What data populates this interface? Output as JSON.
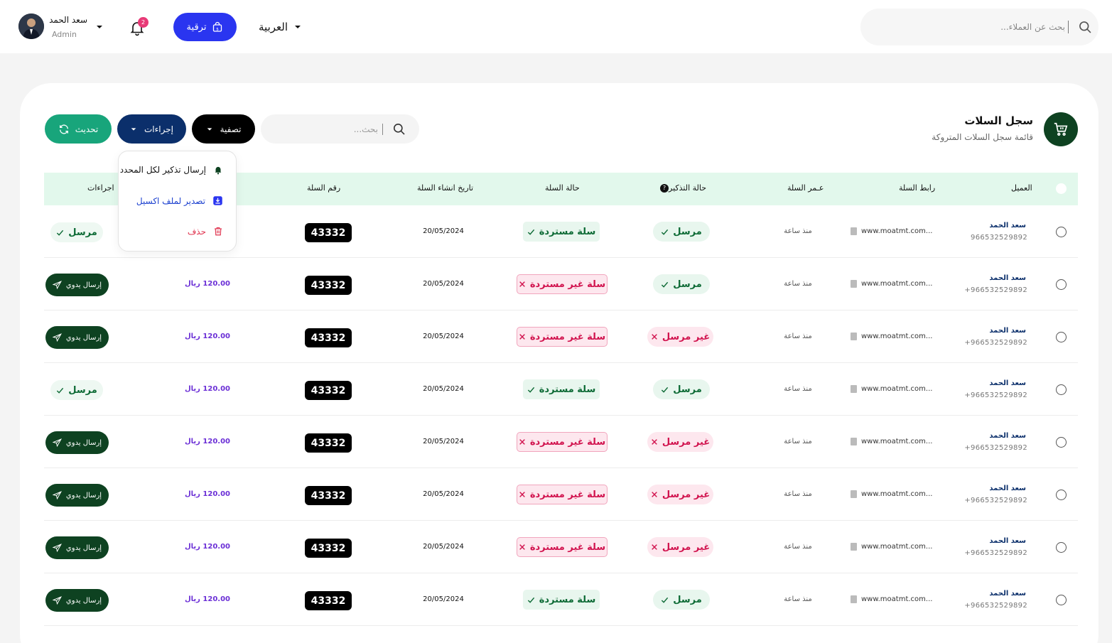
{
  "header": {
    "search_placeholder": "بحث عن العملاء...",
    "language_label": "العربية",
    "upgrade_label": "ترقية",
    "notification_count": "2",
    "user_name": "سعد الحمد",
    "user_role": "Admin"
  },
  "page": {
    "title": "سجل السلات",
    "subtitle": "قائمة سجل السلات المتروكة",
    "search_placeholder": "بحث...",
    "filter_label": "تصفية",
    "actions_label": "إجراءات",
    "refresh_label": "تحديث"
  },
  "actions_menu": {
    "send_reminder_all": "إرسال تذكير لكل المحدد",
    "export_excel": "تصدير لملف اكسيل",
    "delete": "حذف"
  },
  "table": {
    "columns": {
      "client": "العميل",
      "cart_link": "رابط السلة",
      "cart_age": "عـمر السلة",
      "reminder_status": "حالة التذكير",
      "cart_status": "حالة السلة",
      "created_date": "تاريخ انشاء السلة",
      "cart_number": "رقم السلة",
      "actions": "اجراءات"
    },
    "rows": [
      {
        "name": "سعد الحمد",
        "phone": "966532529892",
        "link": "www.moatmt.com...",
        "age": "منذ ساعة",
        "reminder": "مرسل",
        "reminder_sent": true,
        "status": "سلة مستردة",
        "recovered": true,
        "date": "20/05/2024",
        "cart_number": "43332",
        "amount": "",
        "action": "مرسل",
        "action_type": "sent"
      },
      {
        "name": "سعد الحمد",
        "phone": "+966532529892",
        "link": "www.moatmt.com...",
        "age": "منذ ساعة",
        "reminder": "مرسل",
        "reminder_sent": true,
        "status": "سلة غير مستردة",
        "recovered": false,
        "date": "20/05/2024",
        "cart_number": "43332",
        "amount": "120.00 ريال",
        "action": "إرسال يدوي",
        "action_type": "manual"
      },
      {
        "name": "سعد الحمد",
        "phone": "+966532529892",
        "link": "www.moatmt.com...",
        "age": "منذ ساعة",
        "reminder": "غير مرسل",
        "reminder_sent": false,
        "status": "سلة غير مستردة",
        "recovered": false,
        "date": "20/05/2024",
        "cart_number": "43332",
        "amount": "120.00 ريال",
        "action": "إرسال يدوي",
        "action_type": "manual"
      },
      {
        "name": "سعد الحمد",
        "phone": "+966532529892",
        "link": "www.moatmt.com...",
        "age": "منذ ساعة",
        "reminder": "مرسل",
        "reminder_sent": true,
        "status": "سلة مستردة",
        "recovered": true,
        "date": "20/05/2024",
        "cart_number": "43332",
        "amount": "120.00 ريال",
        "action": "مرسل",
        "action_type": "sent"
      },
      {
        "name": "سعد الحمد",
        "phone": "+966532529892",
        "link": "www.moatmt.com...",
        "age": "منذ ساعة",
        "reminder": "غير مرسل",
        "reminder_sent": false,
        "status": "سلة غير مستردة",
        "recovered": false,
        "date": "20/05/2024",
        "cart_number": "43332",
        "amount": "120.00 ريال",
        "action": "إرسال يدوي",
        "action_type": "manual"
      },
      {
        "name": "سعد الحمد",
        "phone": "+966532529892",
        "link": "www.moatmt.com...",
        "age": "منذ ساعة",
        "reminder": "غير مرسل",
        "reminder_sent": false,
        "status": "سلة غير مستردة",
        "recovered": false,
        "date": "20/05/2024",
        "cart_number": "43332",
        "amount": "120.00 ريال",
        "action": "إرسال يدوي",
        "action_type": "manual"
      },
      {
        "name": "سعد الحمد",
        "phone": "+966532529892",
        "link": "www.moatmt.com...",
        "age": "منذ ساعة",
        "reminder": "غير مرسل",
        "reminder_sent": false,
        "status": "سلة غير مستردة",
        "recovered": false,
        "date": "20/05/2024",
        "cart_number": "43332",
        "amount": "120.00 ريال",
        "action": "إرسال يدوي",
        "action_type": "manual"
      },
      {
        "name": "سعد الحمد",
        "phone": "+966532529892",
        "link": "www.moatmt.com...",
        "age": "منذ ساعة",
        "reminder": "مرسل",
        "reminder_sent": true,
        "status": "سلة مستردة",
        "recovered": true,
        "date": "20/05/2024",
        "cart_number": "43332",
        "amount": "120.00 ريال",
        "action": "إرسال يدوي",
        "action_type": "manual"
      }
    ]
  },
  "colors": {
    "primary_blue": "#2a35f0",
    "dark_green": "#0e4221",
    "refresh_green": "#18a57b",
    "navy": "#0b2f6b",
    "header_row_bg": "#e2f8ec",
    "success_text": "#0e6b36",
    "danger_text": "#d1134e",
    "amount_purple": "#6b2fd6",
    "notification_badge": "#e83a77"
  },
  "icons": {
    "search": "search-icon",
    "bell": "bell-icon",
    "upgrade": "shopping-bag-icon",
    "cart": "cart-icon",
    "refresh": "refresh-icon",
    "check": "check-icon",
    "cross": "close-icon",
    "send": "send-icon",
    "download": "download-icon",
    "trash": "trash-icon",
    "link": "document-icon"
  }
}
